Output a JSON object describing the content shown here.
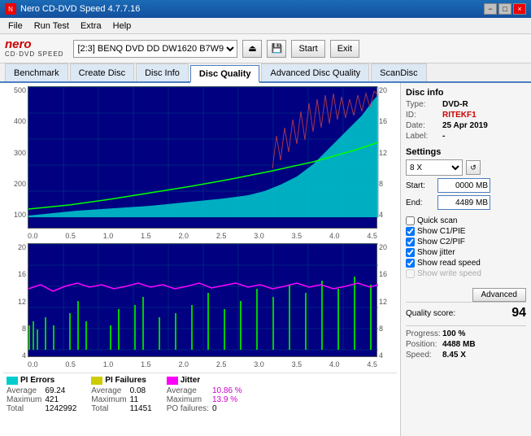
{
  "titleBar": {
    "title": "Nero CD-DVD Speed 4.7.7.16",
    "buttons": [
      "−",
      "□",
      "×"
    ]
  },
  "menuBar": {
    "items": [
      "File",
      "Run Test",
      "Extra",
      "Help"
    ]
  },
  "toolbar": {
    "logoLine1": "nero",
    "logoLine2": "CD·DVD SPEED",
    "driveLabel": "[2:3]  BENQ DVD DD DW1620 B7W9",
    "startLabel": "Start",
    "exitLabel": "Exit"
  },
  "tabs": {
    "items": [
      "Benchmark",
      "Create Disc",
      "Disc Info",
      "Disc Quality",
      "Advanced Disc Quality",
      "ScanDisc"
    ],
    "active": "Disc Quality"
  },
  "discInfo": {
    "title": "Disc info",
    "type_label": "Type:",
    "type_value": "DVD-R",
    "id_label": "ID:",
    "id_value": "RITEKF1",
    "date_label": "Date:",
    "date_value": "25 Apr 2019",
    "label_label": "Label:",
    "label_value": "-"
  },
  "settings": {
    "title": "Settings",
    "speed": "8 X",
    "start_label": "Start:",
    "start_value": "0000 MB",
    "end_label": "End:",
    "end_value": "4489 MB"
  },
  "checkboxes": {
    "quickScan": {
      "label": "Quick scan",
      "checked": false
    },
    "showC1PIE": {
      "label": "Show C1/PIE",
      "checked": true
    },
    "showC2PIF": {
      "label": "Show C2/PIF",
      "checked": true
    },
    "showJitter": {
      "label": "Show jitter",
      "checked": true
    },
    "showReadSpeed": {
      "label": "Show read speed",
      "checked": true
    },
    "showWriteSpeed": {
      "label": "Show write speed",
      "checked": false
    }
  },
  "advancedBtn": "Advanced",
  "qualityScore": {
    "label": "Quality score:",
    "value": "94"
  },
  "progress": {
    "label": "Progress:",
    "value": "100 %",
    "position_label": "Position:",
    "position_value": "4488 MB",
    "speed_label": "Speed:",
    "speed_value": "8.45 X"
  },
  "legend": {
    "pi_errors": {
      "label": "PI Errors",
      "color": "#00ffff",
      "average_label": "Average",
      "average_value": "69.24",
      "maximum_label": "Maximum",
      "maximum_value": "421",
      "total_label": "Total",
      "total_value": "1242992"
    },
    "pi_failures": {
      "label": "PI Failures",
      "color": "#ffff00",
      "average_label": "Average",
      "average_value": "0.08",
      "maximum_label": "Maximum",
      "maximum_value": "11",
      "total_label": "Total",
      "total_value": "11451"
    },
    "jitter": {
      "label": "Jitter",
      "color": "#ff00ff",
      "average_label": "Average",
      "average_value": "10.86 %",
      "maximum_label": "Maximum",
      "maximum_value": "13.9 %",
      "po_label": "PO failures:",
      "po_value": "0"
    }
  },
  "topChart": {
    "yAxisRight": [
      "20",
      "16",
      "12",
      "8",
      "4"
    ],
    "yAxisLeft": [
      "500",
      "400",
      "300",
      "200",
      "100"
    ],
    "xAxis": [
      "0.0",
      "0.5",
      "1.0",
      "1.5",
      "2.0",
      "2.5",
      "3.0",
      "3.5",
      "4.0",
      "4.5"
    ]
  },
  "bottomChart": {
    "yAxisRight": [
      "20",
      "16",
      "12",
      "8",
      "4"
    ],
    "yAxisLeft": [
      "20",
      "16",
      "12",
      "8",
      "4"
    ],
    "xAxis": [
      "0.0",
      "0.5",
      "1.0",
      "1.5",
      "2.0",
      "2.5",
      "3.0",
      "3.5",
      "4.0",
      "4.5"
    ]
  }
}
